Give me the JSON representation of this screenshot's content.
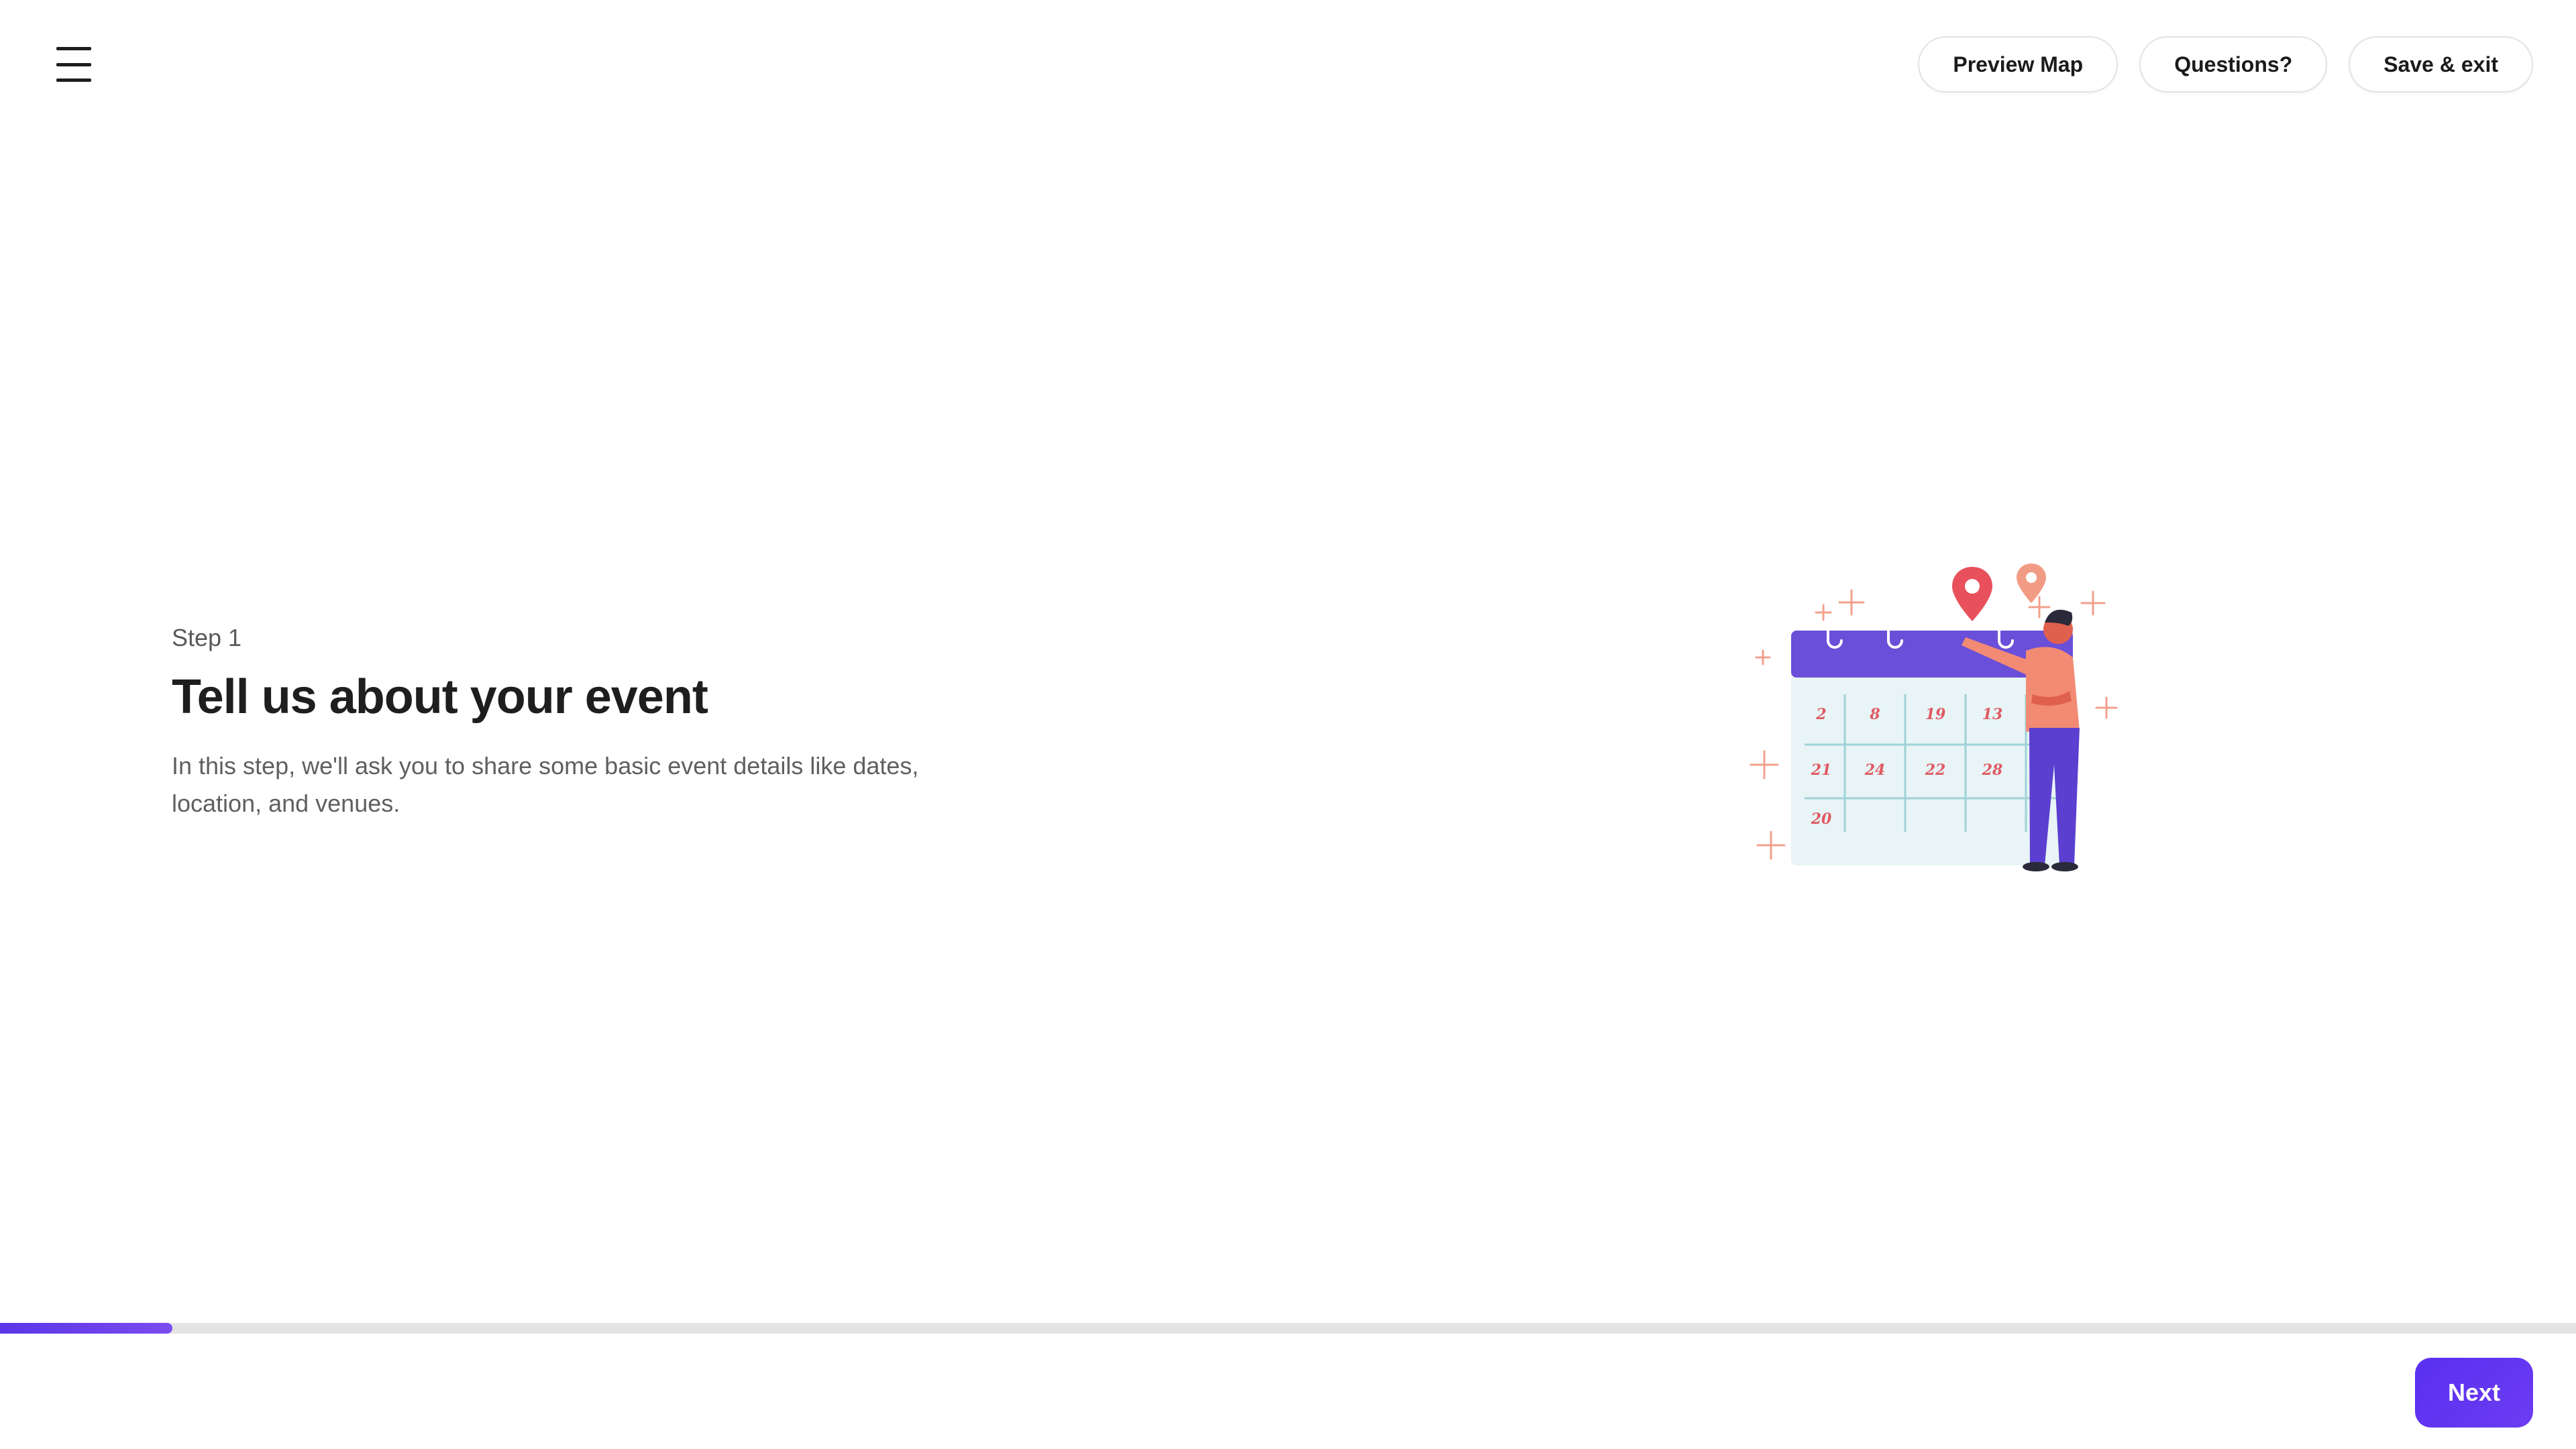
{
  "header": {
    "menu_icon": "hamburger-menu-icon",
    "actions": {
      "preview_map": "Preview Map",
      "questions": "Questions?",
      "save_exit": "Save & exit"
    }
  },
  "main": {
    "step_label": "Step 1",
    "title": "Tell us about your event",
    "description": "In this step, we'll ask you to share some basic event details like dates, location, and venues.",
    "illustration": {
      "icon": "calendar-event-planning-illustration",
      "calendar_dates": [
        "2",
        "8",
        "19",
        "13",
        "21",
        "24",
        "22",
        "28",
        "20"
      ]
    }
  },
  "footer": {
    "progress_fraction": 0.067,
    "next_label": "Next"
  },
  "colors": {
    "accent": "#5b35e8",
    "calendar_header": "#6a4fd8",
    "calendar_body": "#e8f4f6",
    "pin_red": "#e8505b",
    "pin_salmon": "#f08a6e",
    "person_shirt": "#f28a74",
    "person_pants": "#5a3fd0"
  }
}
